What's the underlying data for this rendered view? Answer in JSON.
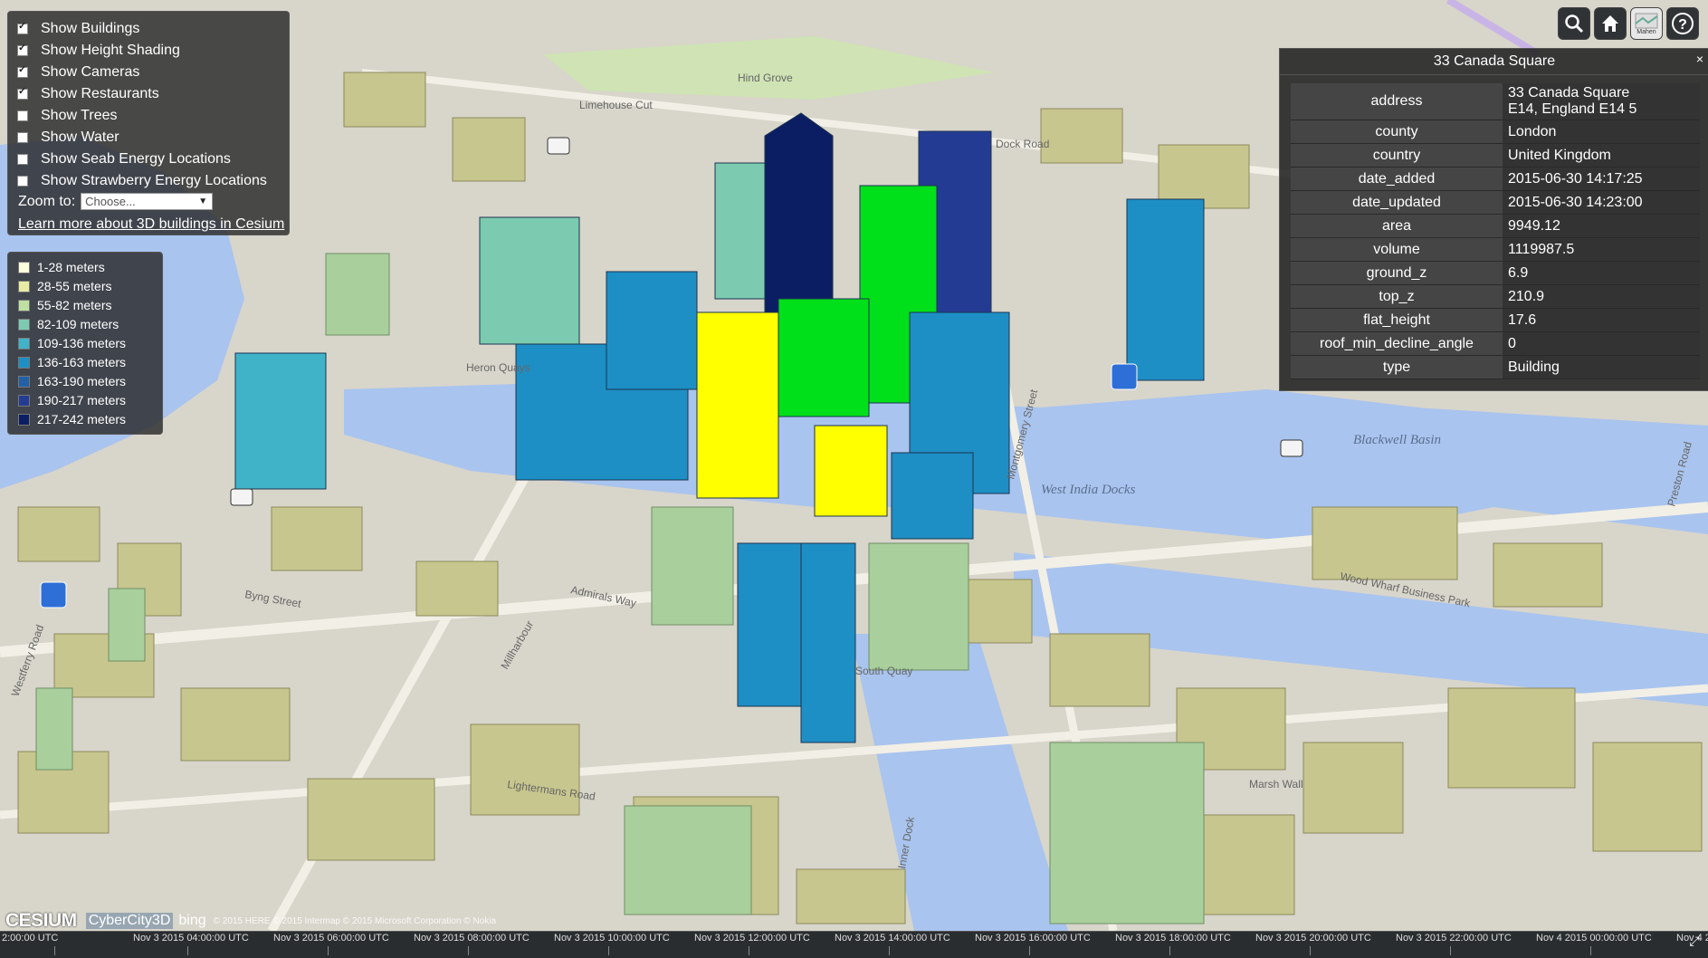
{
  "layers": {
    "items": [
      {
        "label": "Show Buildings",
        "checked": true
      },
      {
        "label": "Show Height Shading",
        "checked": true
      },
      {
        "label": "Show Cameras",
        "checked": true
      },
      {
        "label": "Show Restaurants",
        "checked": true
      },
      {
        "label": "Show Trees",
        "checked": false
      },
      {
        "label": "Show Water",
        "checked": false
      },
      {
        "label": "Show Seab Energy Locations",
        "checked": false
      },
      {
        "label": "Show Strawberry Energy Locations",
        "checked": false
      }
    ],
    "zoom_label": "Zoom to:",
    "zoom_value": "Choose...",
    "learn_link": "Learn more about 3D buildings in Cesium"
  },
  "legend": {
    "items": [
      {
        "label": "1-28 meters",
        "color": "#fdfde0"
      },
      {
        "label": "28-55 meters",
        "color": "#e8eca2"
      },
      {
        "label": "55-82 meters",
        "color": "#bfe0a4"
      },
      {
        "label": "82-109 meters",
        "color": "#7ccbb0"
      },
      {
        "label": "109-136 meters",
        "color": "#40b3c8"
      },
      {
        "label": "136-163 meters",
        "color": "#1e8fc4"
      },
      {
        "label": "163-190 meters",
        "color": "#2261a8"
      },
      {
        "label": "190-217 meters",
        "color": "#243b94"
      },
      {
        "label": "217-242 meters",
        "color": "#0b1e64"
      }
    ]
  },
  "toolbar": {
    "buttons": [
      {
        "name": "search-button",
        "icon": "search-icon"
      },
      {
        "name": "home-button",
        "icon": "home-icon"
      },
      {
        "name": "base-layer-picker-button",
        "icon": "map-layer-icon",
        "label": "Mahen"
      },
      {
        "name": "help-button",
        "icon": "help-icon"
      }
    ]
  },
  "info": {
    "title": "33 Canada Square",
    "close": "×",
    "rows": [
      {
        "key": "address",
        "value": "33 Canada Square",
        "value2": "E14, England E14 5"
      },
      {
        "key": "county",
        "value": "London"
      },
      {
        "key": "country",
        "value": "United Kingdom"
      },
      {
        "key": "date_added",
        "value": "2015-06-30 14:17:25"
      },
      {
        "key": "date_updated",
        "value": "2015-06-30 14:23:00"
      },
      {
        "key": "area",
        "value": "9949.12"
      },
      {
        "key": "volume",
        "value": "1119987.5"
      },
      {
        "key": "ground_z",
        "value": "6.9"
      },
      {
        "key": "top_z",
        "value": "210.9"
      },
      {
        "key": "flat_height",
        "value": "17.6"
      },
      {
        "key": "roof_min_decline_angle",
        "value": "0"
      },
      {
        "key": "type",
        "value": "Building"
      }
    ]
  },
  "map_labels": [
    {
      "text": "West India Docks"
    },
    {
      "text": "Blackwell Basin"
    },
    {
      "text": "Wood Wharf Business Park"
    },
    {
      "text": "Marsh Wall"
    },
    {
      "text": "Lightermans Road"
    },
    {
      "text": "Limehouse Cut"
    },
    {
      "text": "Montgomery Street"
    },
    {
      "text": "Westferry Road"
    },
    {
      "text": "Byng Street"
    },
    {
      "text": "South Quay"
    },
    {
      "text": "Hind Grove"
    },
    {
      "text": "Dock Road"
    },
    {
      "text": "Admirals Way"
    },
    {
      "text": "Millharbour"
    },
    {
      "text": "Inner Dock"
    },
    {
      "text": "Preston Road"
    },
    {
      "text": "Heron Quays"
    }
  ],
  "credits": {
    "cesium": "CESIUM",
    "cybercity": "CyberCity3D",
    "bing": "bing",
    "attribution": "© 2015 HERE © 2015 Intermap © 2015 Microsoft Corporation © Nokia"
  },
  "timeline": {
    "labels": [
      "2:00:00 UTC",
      "Nov 3 2015 04:00:00 UTC",
      "Nov 3 2015 06:00:00 UTC",
      "Nov 3 2015 08:00:00 UTC",
      "Nov 3 2015 10:00:00 UTC",
      "Nov 3 2015 12:00:00 UTC",
      "Nov 3 2015 14:00:00 UTC",
      "Nov 3 2015 16:00:00 UTC",
      "Nov 3 2015 18:00:00 UTC",
      "Nov 3 2015 20:00:00 UTC",
      "Nov 3 2015 22:00:00 UTC",
      "Nov 4 2015 00:00:00 UTC",
      "Nov 4 2015 0"
    ]
  }
}
